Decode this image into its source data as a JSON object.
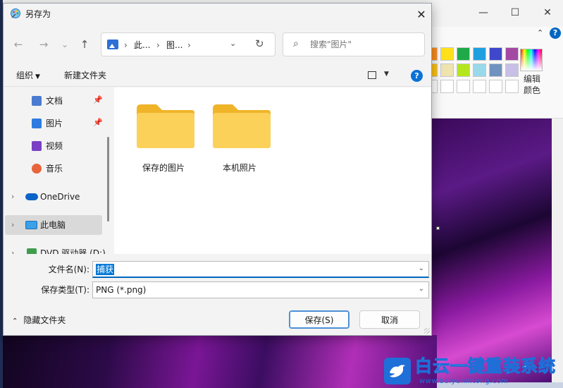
{
  "dialog": {
    "title": "另存为",
    "close_glyph": "✕",
    "nav": {
      "back_glyph": "←",
      "forward_glyph": "→",
      "recent_glyph": "⌄",
      "up_glyph": "↑"
    },
    "address": {
      "segments": [
        "此...",
        "图..."
      ],
      "separator": "›",
      "dropdown_glyph": "⌄",
      "refresh_glyph": "↻"
    },
    "search": {
      "placeholder": "搜索\"图片\"",
      "icon": "search-icon"
    },
    "toolbar": {
      "organize_label": "组织",
      "new_folder_label": "新建文件夹",
      "help_glyph": "?"
    },
    "nav_pane": {
      "items": [
        {
          "label": "文档",
          "icon": "documents-icon",
          "pinned": true
        },
        {
          "label": "图片",
          "icon": "pictures-icon",
          "pinned": true
        },
        {
          "label": "视频",
          "icon": "videos-icon",
          "pinned": false
        },
        {
          "label": "音乐",
          "icon": "music-icon",
          "pinned": false
        },
        {
          "label": "OneDrive",
          "icon": "onedrive-icon",
          "expandable": true
        },
        {
          "label": "此电脑",
          "icon": "this-pc-icon",
          "expandable": true,
          "selected": true
        },
        {
          "label": "DVD 驱动器 (D:)",
          "icon": "dvd-drive-icon",
          "expandable": true
        }
      ]
    },
    "folders": [
      {
        "name": "保存的图片"
      },
      {
        "name": "本机照片"
      }
    ],
    "form": {
      "filename_label": "文件名(N):",
      "filename_value": "捕获",
      "filetype_label": "保存类型(T):",
      "filetype_value": "PNG (*.png)",
      "hide_folders_label": "隐藏文件夹",
      "save_label": "保存(S)",
      "cancel_label": "取消"
    }
  },
  "background_app": {
    "window_controls": {
      "minimize": "—",
      "maximize": "☐",
      "close": "✕"
    },
    "ribbon_toggle_glyph": "⌃",
    "help_glyph": "?",
    "palette_colors": [
      "#ff8c1a",
      "#ffe11a",
      "#1faa4a",
      "#1ea0e0",
      "#3f48cc",
      "#a349a4",
      "#ffc20e",
      "#efe4b0",
      "#b5e61d",
      "#99d9ea",
      "#7092be",
      "#c8bfe7",
      "#ffffff",
      "#ffffff",
      "#ffffff",
      "#ffffff",
      "#ffffff",
      "#ffffff"
    ],
    "edit_colors_label": "编辑颜色"
  },
  "watermark": {
    "title": "白云一键重装系统",
    "url": "www.baiyunxitong.com"
  }
}
